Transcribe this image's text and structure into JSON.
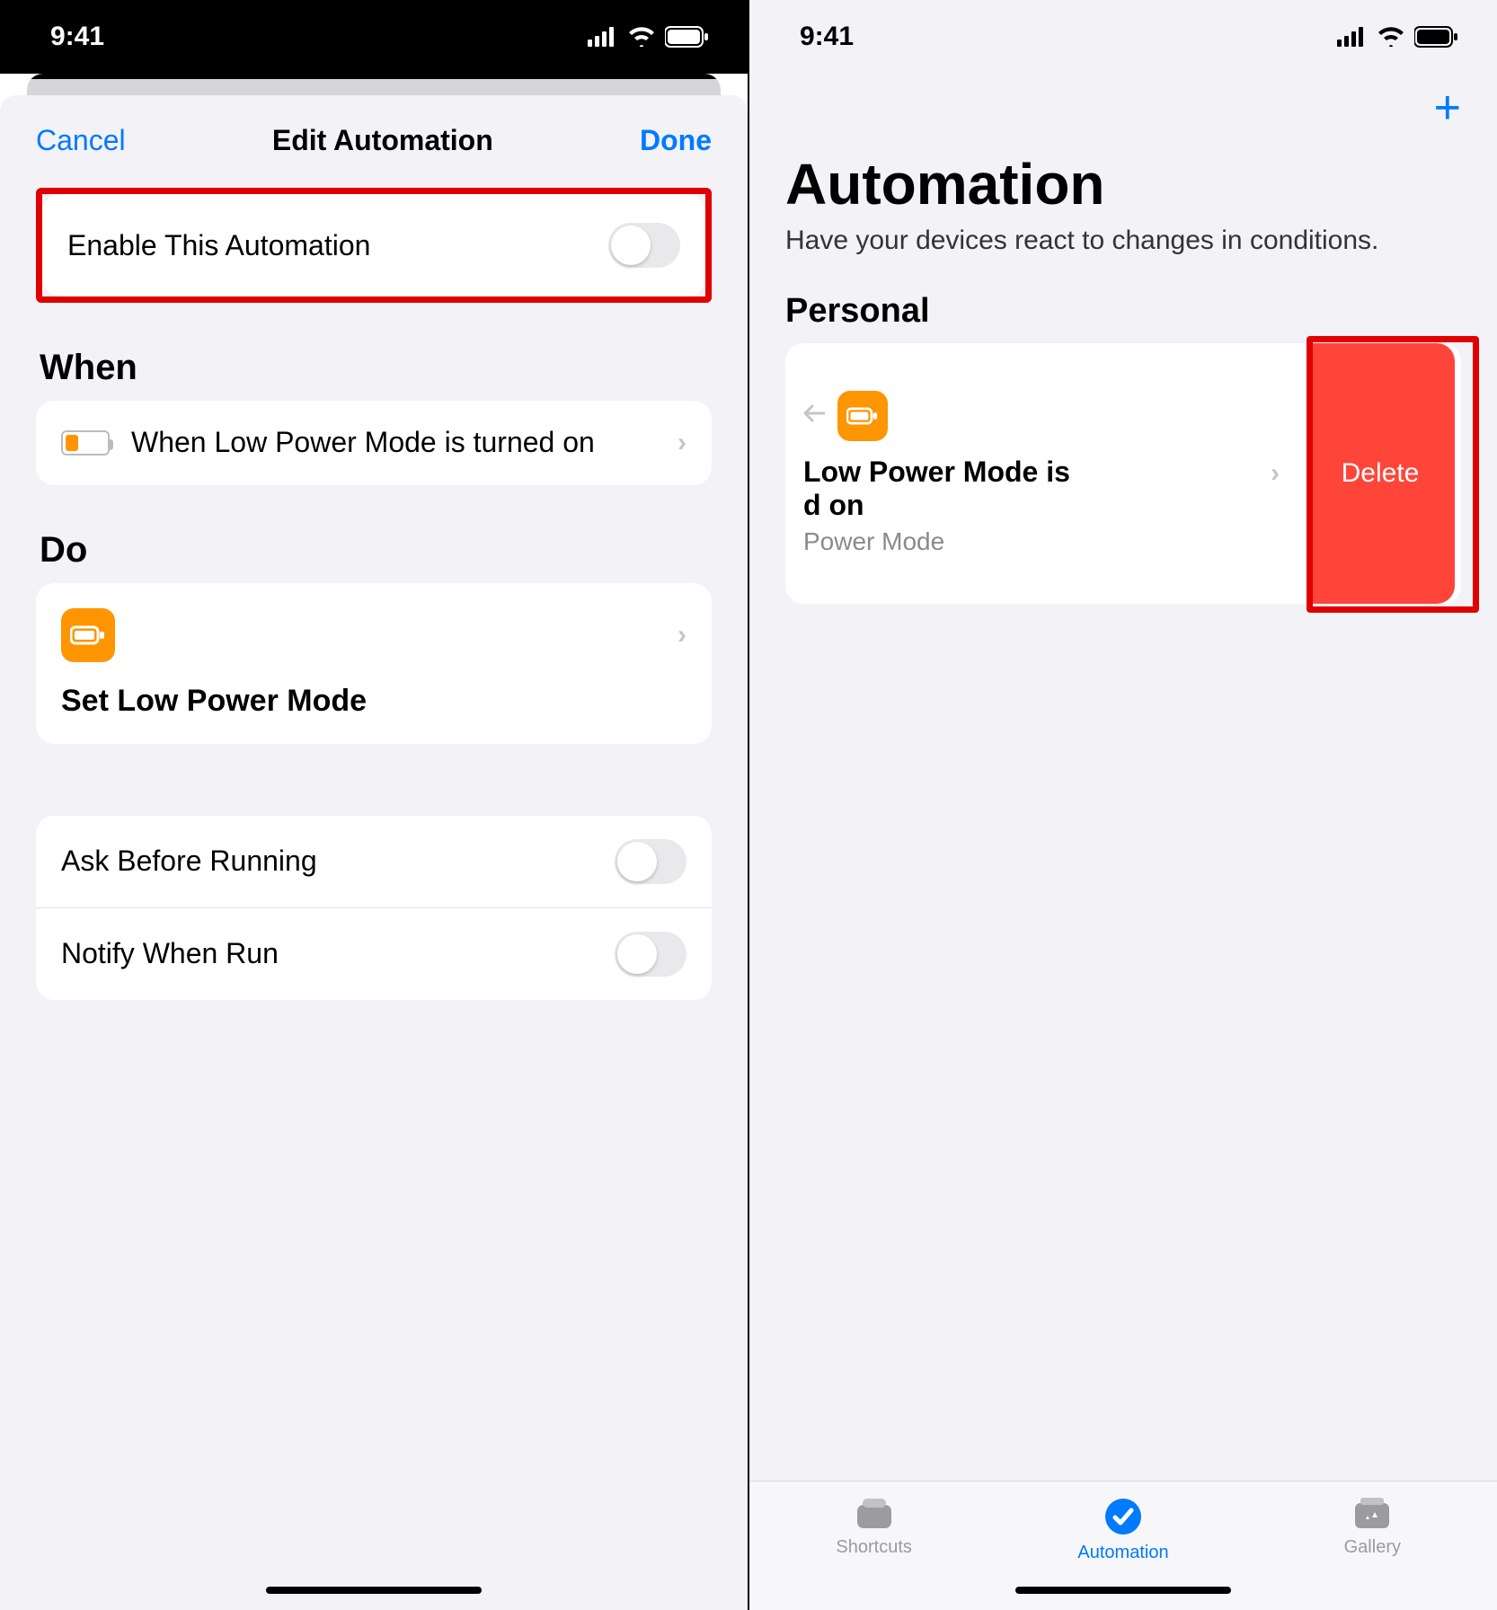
{
  "status": {
    "time": "9:41"
  },
  "left": {
    "nav": {
      "cancel": "Cancel",
      "title": "Edit Automation",
      "done": "Done"
    },
    "enable_row": {
      "label": "Enable This Automation",
      "on": false
    },
    "when": {
      "header": "When",
      "trigger_text": "When Low Power Mode is turned on"
    },
    "do": {
      "header": "Do",
      "action_text": "Set Low Power Mode"
    },
    "options": {
      "ask_before_running": {
        "label": "Ask Before Running",
        "on": false
      },
      "notify_when_run": {
        "label": "Notify When Run",
        "on": false
      }
    }
  },
  "right": {
    "title": "Automation",
    "subtitle": "Have your devices react to changes in conditions.",
    "section": "Personal",
    "item": {
      "line1": "Low Power Mode is",
      "line2": "d on",
      "line3": "Power Mode"
    },
    "delete_label": "Delete",
    "tabs": {
      "shortcuts": "Shortcuts",
      "automation": "Automation",
      "gallery": "Gallery"
    }
  }
}
